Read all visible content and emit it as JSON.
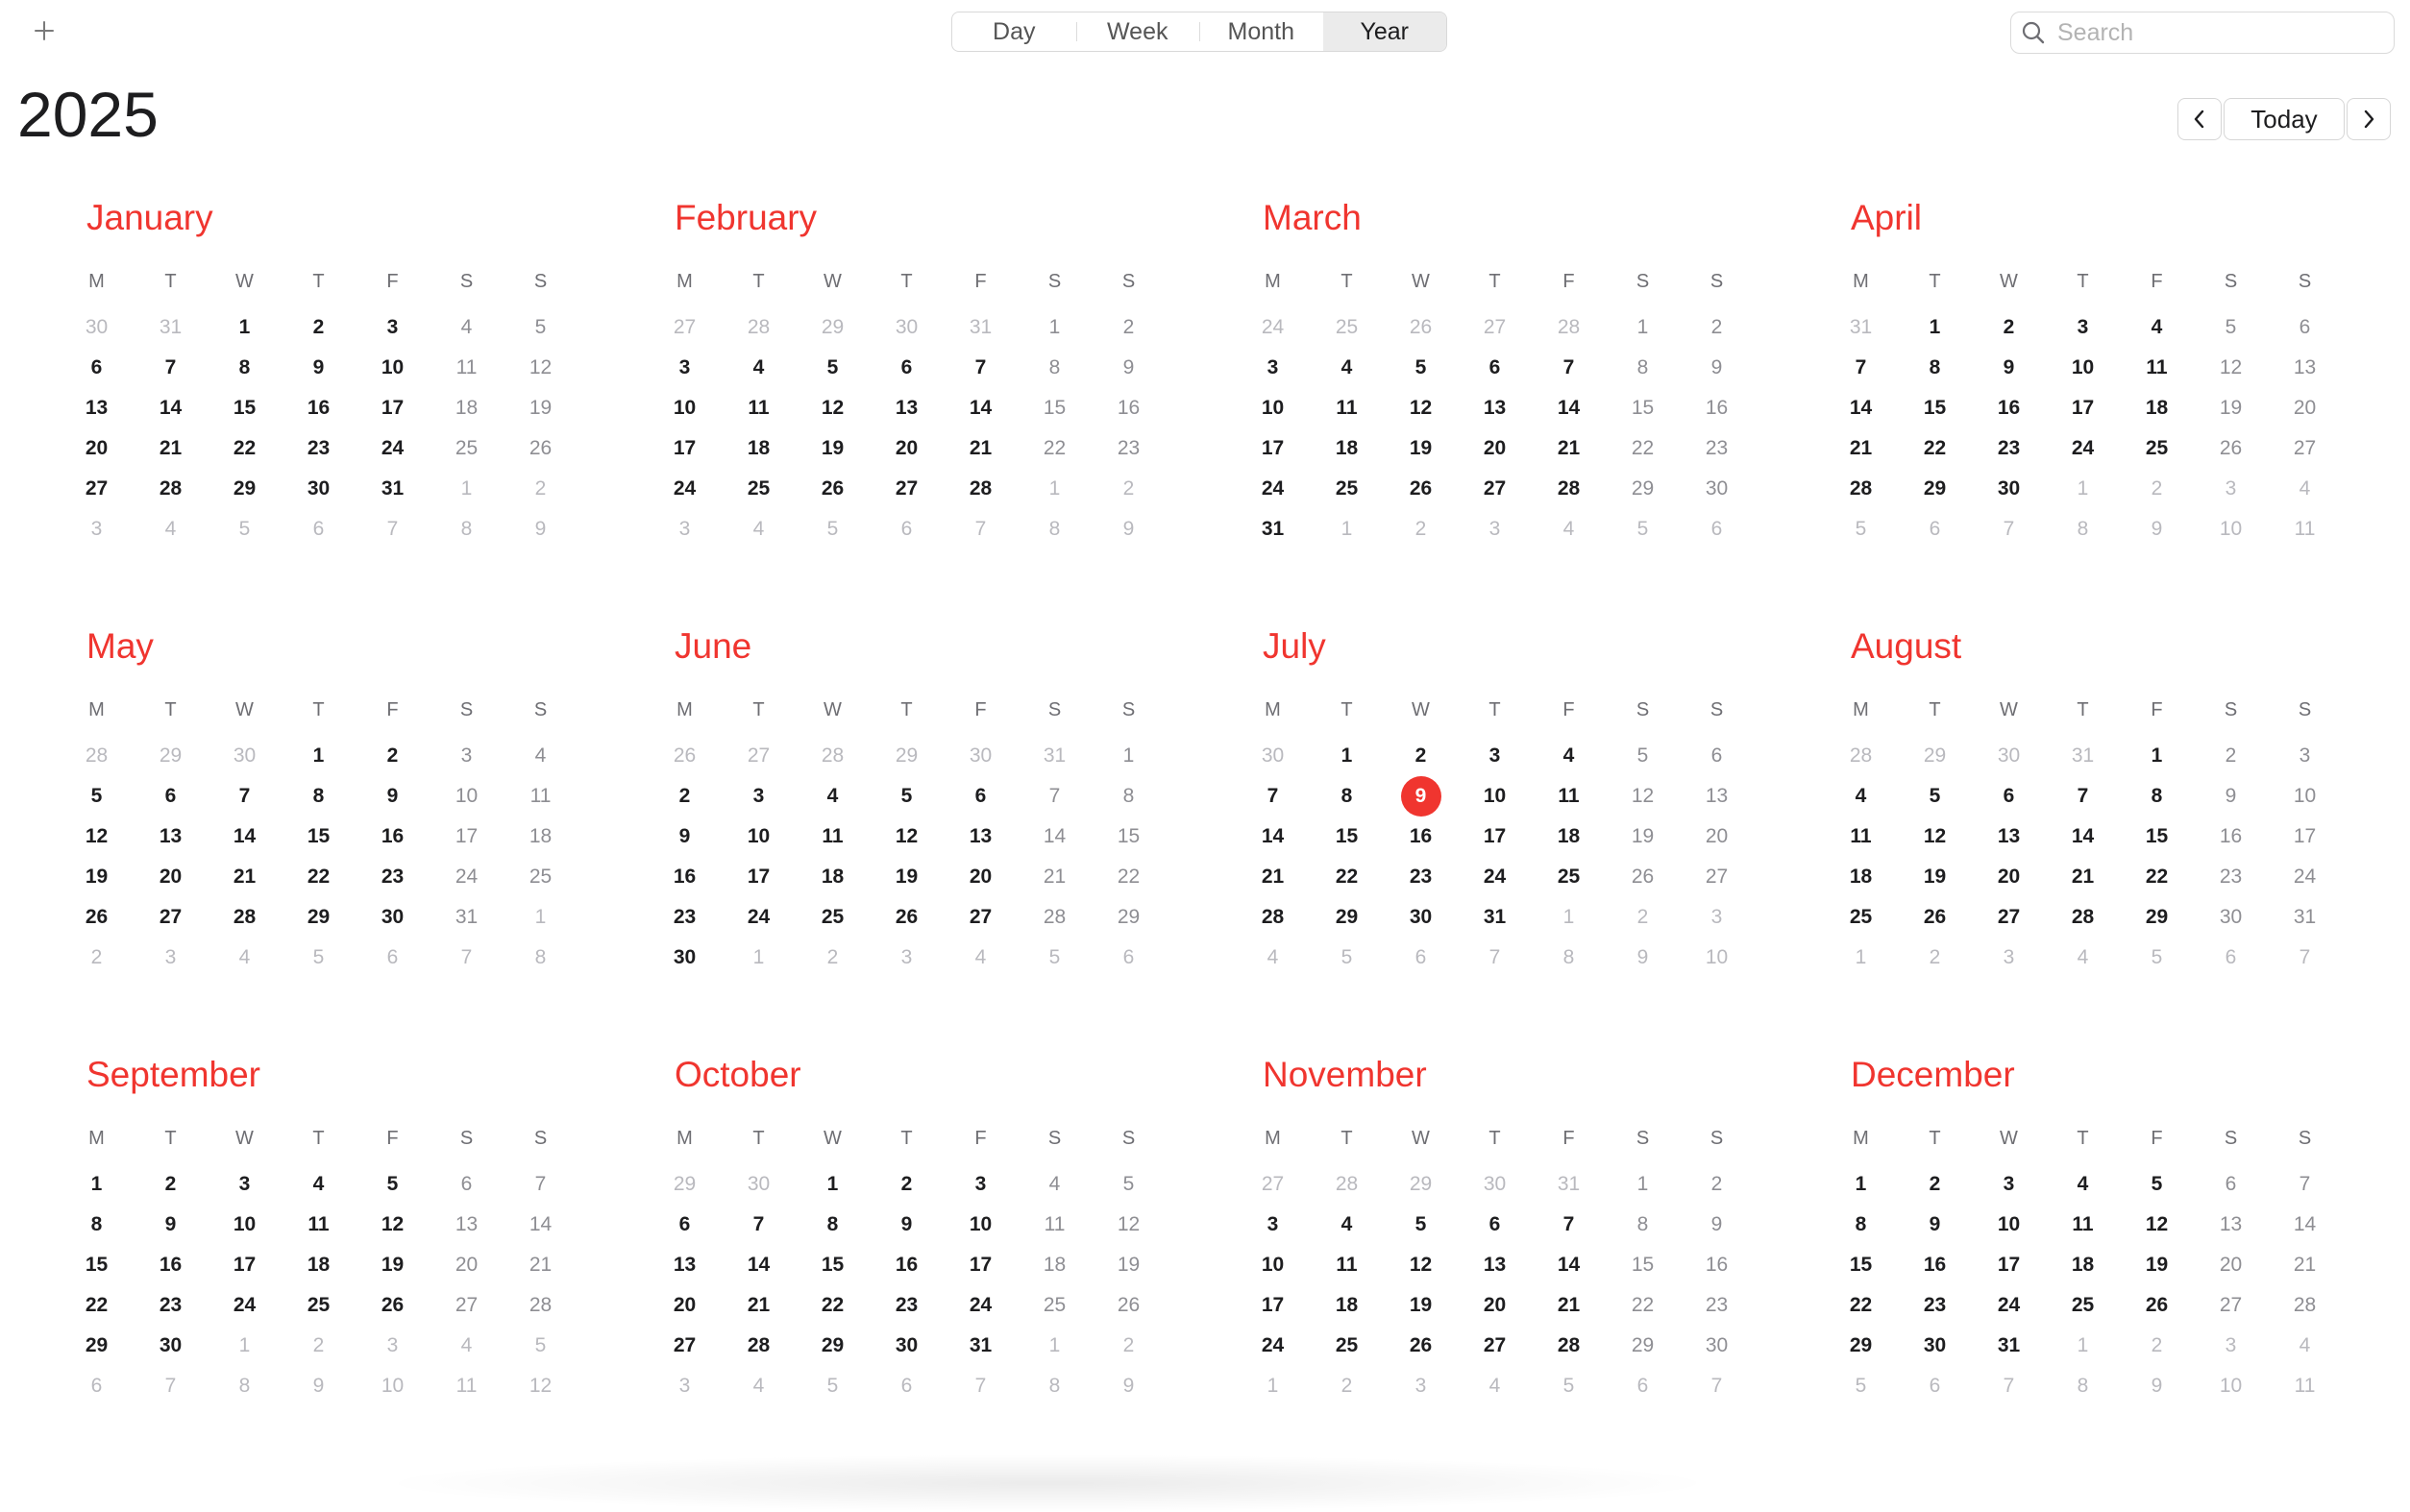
{
  "toolbar": {
    "add_icon": "plus-icon",
    "views": [
      "Day",
      "Week",
      "Month",
      "Year"
    ],
    "active_view": "Year",
    "search_placeholder": "Search",
    "search_icon": "magnifier-icon"
  },
  "header": {
    "year": "2025",
    "today_label": "Today",
    "prev_icon": "chevron-left-icon",
    "next_icon": "chevron-right-icon"
  },
  "calendar": {
    "weekday_labels": [
      "M",
      "T",
      "W",
      "T",
      "F",
      "S",
      "S"
    ],
    "today": {
      "month": 7,
      "day": 9
    },
    "accent_color": "#f0352f",
    "months": [
      "January",
      "February",
      "March",
      "April",
      "May",
      "June",
      "July",
      "August",
      "September",
      "October",
      "November",
      "December"
    ]
  }
}
